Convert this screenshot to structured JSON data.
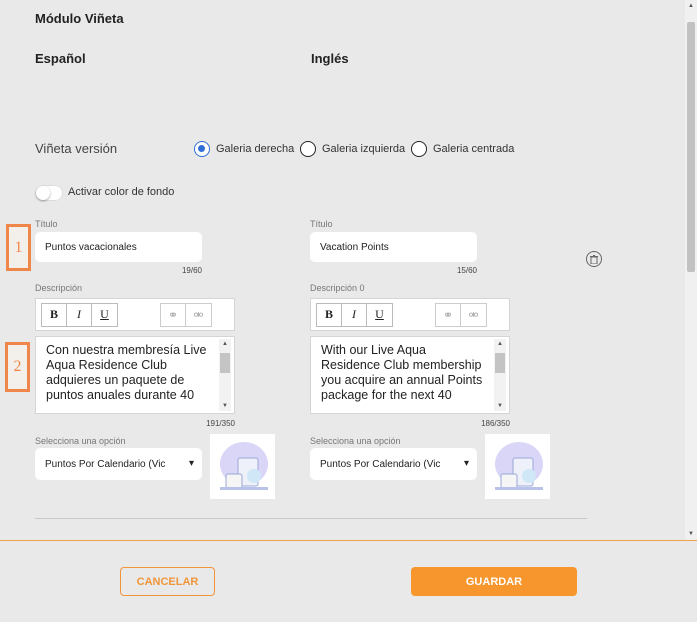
{
  "module": {
    "title": "Módulo Viñeta"
  },
  "languages": {
    "es": "Español",
    "en": "Inglés"
  },
  "version": {
    "label": "Viñeta versión",
    "options": [
      "Galeria derecha",
      "Galeria izquierda",
      "Galeria centrada"
    ],
    "selected": "Galeria derecha"
  },
  "background_toggle": {
    "label": "Activar color de fondo",
    "on": false
  },
  "markers": [
    "1",
    "2"
  ],
  "es": {
    "title_label": "Título",
    "title_value": "Puntos vacacionales",
    "title_count": "19/60",
    "desc_label": "Descripción",
    "desc_value": "Con nuestra membresía Live Aqua Residence Club adquieres un paquete de puntos anuales durante 40",
    "desc_count": "191/350",
    "select_label": "Selecciona una opción",
    "select_value": "Puntos Por Calendario (Vic"
  },
  "en": {
    "title_label": "Título",
    "title_value": "Vacation Points",
    "title_count": "15/60",
    "desc_label": "Descripción 0",
    "desc_value": "With our Live Aqua Residence Club membership you acquire an annual Points package for the next 40",
    "desc_count": "186/350",
    "select_label": "Selecciona una opción",
    "select_value": "Puntos Por Calendario (Vic"
  },
  "toolbar": {
    "bold": "B",
    "italic": "I",
    "underline": "U"
  },
  "actions": {
    "cancel": "CANCELAR",
    "save": "GUARDAR"
  },
  "colors": {
    "accent": "#f7962c",
    "radio_selected": "#2f6fd6",
    "marker": "#f0874a"
  }
}
